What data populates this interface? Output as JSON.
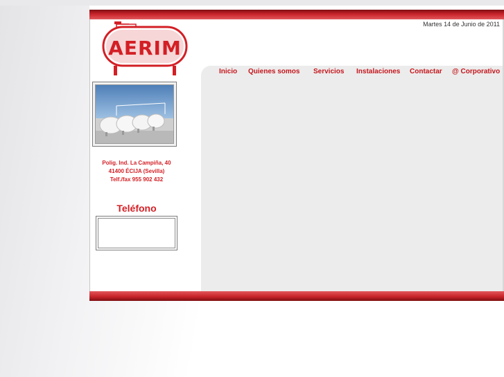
{
  "header": {
    "date": "Martes 14 de Junio de 2011",
    "logo_text": "AERIM"
  },
  "nav": {
    "items": [
      {
        "label": "Inicio"
      },
      {
        "label": "Quienes somos"
      },
      {
        "label": "Servicios"
      },
      {
        "label": "Instalaciones"
      },
      {
        "label": "Contactar"
      },
      {
        "label": "@ Corporativo"
      }
    ]
  },
  "sidebar": {
    "address_lines": [
      "Polig. Ind. La Campiña, 40",
      "41400 ÉCIJA (Sevilla)",
      "Telf./fax 955 902 432"
    ],
    "phone_title": "Teléfono"
  },
  "colors": {
    "brand_red": "#d31f25",
    "nav_red": "#c4161c",
    "bar_dark": "#7e0f12",
    "panel_gray": "#ececec"
  }
}
